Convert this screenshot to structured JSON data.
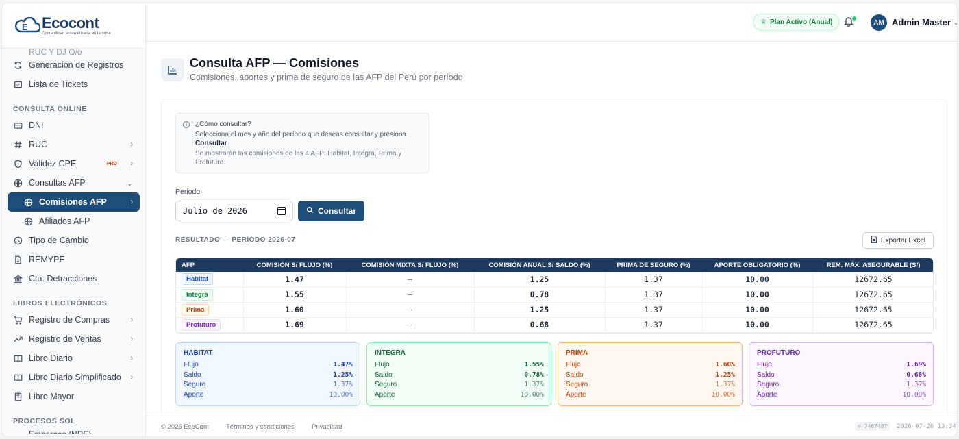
{
  "brand": {
    "name": "Ecocont",
    "tagline": "Contabilidad automatizada en la nube"
  },
  "sidebar": {
    "cut_item": "RUC Y DJ O/o",
    "items_top": [
      {
        "label": "Generación de Registros",
        "icon": "refresh-icon"
      },
      {
        "label": "Lista de Tickets",
        "icon": "ticket-icon"
      }
    ],
    "section_consulta": "CONSULTA ONLINE",
    "dni": "DNI",
    "ruc": "RUC",
    "validez": "Validez CPE",
    "pro_badge": "PRO",
    "consultas_afp": "Consultas AFP",
    "comisiones_afp": "Comisiones AFP",
    "afiliados_afp": "Afiliados AFP",
    "tipo_cambio": "Tipo de Cambio",
    "remype": "REMYPE",
    "detracciones": "Cta. Detracciones",
    "section_libros": "LIBROS ELECTRÓNICOS",
    "registro_compras": "Registro de Compras",
    "registro_ventas": "Registro de Ventas",
    "libro_diario": "Libro Diario",
    "libro_diario_simpl": "Libro Diario Simplificado",
    "libro_mayor": "Libro Mayor",
    "section_procesos": "PROCESOS SOL",
    "cut_bottom": "Embargos (NRE)"
  },
  "header": {
    "plan": "Plan Activo (Anual)",
    "avatar": "AM",
    "user": "Admin Master"
  },
  "page": {
    "title": "Consulta AFP — Comisiones",
    "subtitle": "Comisiones, aportes y prima de seguro de las AFP del Perú por período"
  },
  "info": {
    "question": "¿Cómo consultar?",
    "line1": "Selecciona el mes y año del período que deseas consultar y presiona",
    "line1_bold": "Consultar",
    "line2": "Se mostrarán las comisiones de las 4 AFP: Habitat, Integra, Prima y Profuturo."
  },
  "form": {
    "period_label": "Periodo",
    "period_value": "Julio de 2026",
    "consult_button": "Consultar"
  },
  "results": {
    "label": "RESULTADO — PERÍODO 2026-07",
    "export_button": "Exportar Excel",
    "columns": [
      "AFP",
      "COMISIÓN S/ FLUJO (%)",
      "COMISIÓN MIXTA S/ FLUJO (%)",
      "COMISIÓN ANUAL S/ SALDO (%)",
      "PRIMA DE SEGURO (%)",
      "APORTE OBLIGATORIO (%)",
      "REM. MÁX. ASEGURABLE (S/)"
    ],
    "rows": [
      {
        "afp": "Habitat",
        "flujo": "1.47",
        "mixta": "—",
        "saldo": "1.25",
        "prima": "1.37",
        "aporte": "10.00",
        "rem": "12672.65",
        "color": "#1d4ed8",
        "bg": "#eff6ff",
        "border": "#bfdbfe"
      },
      {
        "afp": "Integra",
        "flujo": "1.55",
        "mixta": "—",
        "saldo": "0.78",
        "prima": "1.37",
        "aporte": "10.00",
        "rem": "12672.65",
        "color": "#15803d",
        "bg": "#f0fdf4",
        "border": "#bbf7d0"
      },
      {
        "afp": "Prima",
        "flujo": "1.60",
        "mixta": "—",
        "saldo": "1.25",
        "prima": "1.37",
        "aporte": "10.00",
        "rem": "12672.65",
        "color": "#c2410c",
        "bg": "#fff7ed",
        "border": "#fed7aa"
      },
      {
        "afp": "Profuturo",
        "flujo": "1.69",
        "mixta": "—",
        "saldo": "0.68",
        "prima": "1.37",
        "aporte": "10.00",
        "rem": "12672.65",
        "color": "#7e22ce",
        "bg": "#faf5ff",
        "border": "#e9d5ff"
      }
    ]
  },
  "cards": {
    "labels": {
      "flujo": "Flujo",
      "saldo": "Saldo",
      "seguro": "Seguro",
      "aporte": "Aporte"
    },
    "items": [
      {
        "name": "HABITAT",
        "flujo": "1.47%",
        "saldo": "1.25%",
        "seguro": "1.37%",
        "aporte": "10.00%",
        "color": "#1e40af",
        "bg": "#f0f7ff",
        "border": "#bfdbfe"
      },
      {
        "name": "INTEGRA",
        "flujo": "1.55%",
        "saldo": "0.78%",
        "seguro": "1.37%",
        "aporte": "10.00%",
        "color": "#166534",
        "bg": "#f0fdf4",
        "border": "#86efac"
      },
      {
        "name": "PRIMA",
        "flujo": "1.60%",
        "saldo": "1.25%",
        "seguro": "1.37%",
        "aporte": "10.00%",
        "color": "#c2410c",
        "bg": "#fff7ed",
        "border": "#fdba74"
      },
      {
        "name": "PROFUTURO",
        "flujo": "1.69%",
        "saldo": "0.68%",
        "seguro": "1.37%",
        "aporte": "10.00%",
        "color": "#6b21a8",
        "bg": "#faf5ff",
        "border": "#d8b4fe"
      }
    ]
  },
  "footer": {
    "copyright": "© 2026 EcoCont",
    "terms": "Términos y condiciones",
    "privacy": "Privacidad",
    "version": "⊙ 7467487",
    "timestamp": "2026-07-26 13:34"
  }
}
